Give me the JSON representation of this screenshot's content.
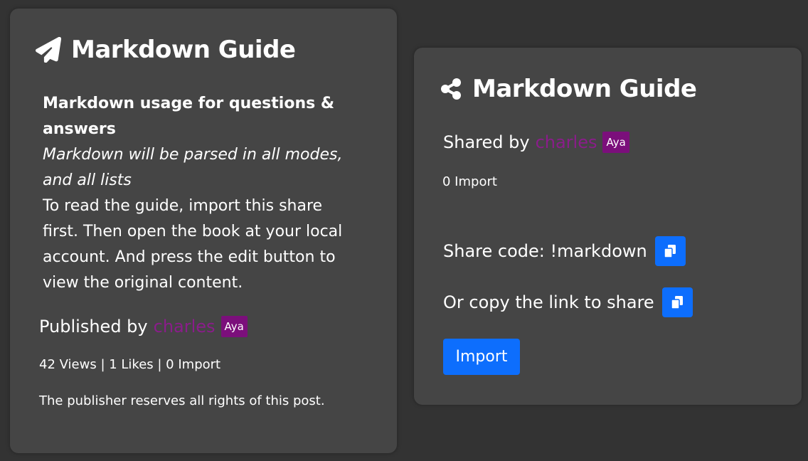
{
  "left_card": {
    "title": "Markdown Guide",
    "title_icon": "paper-plane-icon",
    "description": {
      "bold": "Markdown usage for questions & answers",
      "italic": "Markdown will be parsed in all modes, and all lists",
      "body": "To read the guide, import this share first. Then open the book at your local account. And press the edit button to view the original content."
    },
    "published_label": "Published by",
    "author": "charles",
    "author_badge": "Aya",
    "stats": "42 Views | 1 Likes | 0 Import",
    "rights": "The publisher reserves all rights of this post."
  },
  "right_card": {
    "title": "Markdown Guide",
    "title_icon": "share-nodes-icon",
    "shared_label": "Shared by",
    "author": "charles",
    "author_badge": "Aya",
    "import_count": "0 Import",
    "share_code_label": "Share code: !markdown",
    "copy_link_label": "Or copy the link to share",
    "copy_icon": "copy-icon",
    "import_button": "Import"
  },
  "colors": {
    "page_bg": "#333333",
    "card_bg": "#454545",
    "author": "#8a1d8a",
    "badge_bg": "#7b0f7b",
    "button": "#0d6efd"
  }
}
